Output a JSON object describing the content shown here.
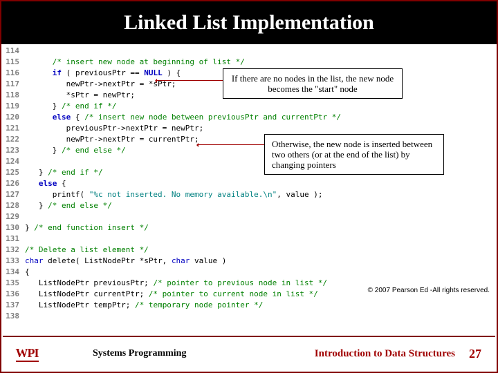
{
  "title": "Linked List Implementation",
  "callouts": {
    "c1": "If there are no nodes in the list, the new node becomes the \"start\" node",
    "c2": "Otherwise, the new node is inserted between two others (or at the end of the list) by changing pointers"
  },
  "copyright": "© 2007 Pearson Ed -All rights reserved.",
  "footer": {
    "logo": "WPI",
    "left": "Systems Programming",
    "right": "Introduction to Data Structures",
    "page": "27"
  },
  "lines": [
    {
      "n": "114",
      "t": ""
    },
    {
      "n": "115",
      "t": "      /* insert new node at beginning of list */",
      "cls": "cm"
    },
    {
      "n": "116",
      "t": "      if ( previousPtr == NULL ) {",
      "mix": [
        [
          "kw",
          "      if"
        ],
        [
          "pl",
          " ( previousPtr == "
        ],
        [
          "kw",
          "NULL"
        ],
        [
          "pl",
          " ) {"
        ]
      ]
    },
    {
      "n": "117",
      "t": "         newPtr->nextPtr = *sPtr;",
      "cls": "pl"
    },
    {
      "n": "118",
      "t": "         *sPtr = newPtr;",
      "cls": "pl"
    },
    {
      "n": "119",
      "t": "      } /* end if */",
      "mix": [
        [
          "pl",
          "      } "
        ],
        [
          "cm",
          "/* end if */"
        ]
      ]
    },
    {
      "n": "120",
      "t": "      else { /* insert new node between previousPtr and currentPtr */",
      "mix": [
        [
          "kw",
          "      else"
        ],
        [
          "pl",
          " { "
        ],
        [
          "cm",
          "/* insert new node between previousPtr and currentPtr */"
        ]
      ]
    },
    {
      "n": "121",
      "t": "         previousPtr->nextPtr = newPtr;",
      "cls": "pl"
    },
    {
      "n": "122",
      "t": "         newPtr->nextPtr = currentPtr;",
      "cls": "pl"
    },
    {
      "n": "123",
      "t": "      } /* end else */",
      "mix": [
        [
          "pl",
          "      } "
        ],
        [
          "cm",
          "/* end else */"
        ]
      ]
    },
    {
      "n": "124",
      "t": ""
    },
    {
      "n": "125",
      "t": "   } /* end if */",
      "mix": [
        [
          "pl",
          "   } "
        ],
        [
          "cm",
          "/* end if */"
        ]
      ]
    },
    {
      "n": "126",
      "t": "   else {",
      "mix": [
        [
          "kw",
          "   else"
        ],
        [
          "pl",
          " {"
        ]
      ]
    },
    {
      "n": "127",
      "t": "      printf( \"%c not inserted. No memory available.\\n\", value );",
      "mix": [
        [
          "pl",
          "      printf( "
        ],
        [
          "str",
          "\"%c not inserted. No memory available.\\n\""
        ],
        [
          "pl",
          ", value );"
        ]
      ]
    },
    {
      "n": "128",
      "t": "   } /* end else */",
      "mix": [
        [
          "pl",
          "   } "
        ],
        [
          "cm",
          "/* end else */"
        ]
      ]
    },
    {
      "n": "129",
      "t": ""
    },
    {
      "n": "130",
      "t": "} /* end function insert */",
      "mix": [
        [
          "pl",
          "} "
        ],
        [
          "cm",
          "/* end function insert */"
        ]
      ]
    },
    {
      "n": "131",
      "t": ""
    },
    {
      "n": "132",
      "t": "/* Delete a list element */",
      "cls": "cm"
    },
    {
      "n": "133",
      "t": "char delete( ListNodePtr *sPtr, char value )",
      "mix": [
        [
          "ty",
          "char"
        ],
        [
          "pl",
          " delete( ListNodePtr *sPtr, "
        ],
        [
          "ty",
          "char"
        ],
        [
          "pl",
          " value )"
        ]
      ]
    },
    {
      "n": "134",
      "t": "{",
      "cls": "pl"
    },
    {
      "n": "135",
      "t": "   ListNodePtr previousPtr; /* pointer to previous node in list */",
      "mix": [
        [
          "pl",
          "   ListNodePtr previousPtr; "
        ],
        [
          "cm",
          "/* pointer to previous node in list */"
        ]
      ]
    },
    {
      "n": "136",
      "t": "   ListNodePtr currentPtr; /* pointer to current node in list */",
      "mix": [
        [
          "pl",
          "   ListNodePtr currentPtr; "
        ],
        [
          "cm",
          "/* pointer to current node in list */"
        ]
      ]
    },
    {
      "n": "137",
      "t": "   ListNodePtr tempPtr; /* temporary node pointer */",
      "mix": [
        [
          "pl",
          "   ListNodePtr tempPtr; "
        ],
        [
          "cm",
          "/* temporary node pointer */"
        ]
      ]
    },
    {
      "n": "138",
      "t": ""
    }
  ]
}
